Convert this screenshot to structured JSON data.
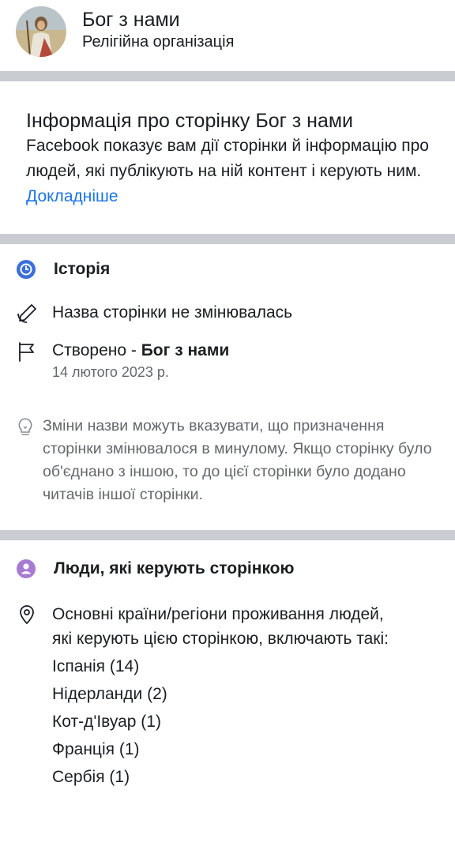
{
  "header": {
    "page_name": "Бог з нами",
    "category": "Релігійна організація"
  },
  "about": {
    "title": "Інформація про сторінку Бог з нами",
    "text": "Facebook показує вам дії сторінки й інформацію про людей, які публікують на ній контент і керують ним. ",
    "link": "Докладніше"
  },
  "history": {
    "title": "Історія",
    "name_unchanged": "Назва сторінки не змінювалась",
    "created_prefix": "Створено - ",
    "created_name": "Бог з нами",
    "created_date": "14 лютого 2023 р.",
    "tip": "Зміни назви можуть вказувати, що призначення сторінки змінювалося в минулому. Якщо сторінку було об'єднано з іншою, то до цієї сторінки було додано читачів іншої сторінки."
  },
  "people": {
    "title": "Люди, які керують сторінкою",
    "countries_intro": "Основні країни/регіони проживання людей, які керують цією сторінкою, включають такі:",
    "countries": [
      "Іспанія (14)",
      "Нідерланди (2)",
      "Кот-д'Івуар (1)",
      "Франція (1)",
      "Сербія (1)"
    ]
  },
  "icons": {
    "history": "clock-icon",
    "rename": "pencil-icon",
    "created": "flag-icon",
    "tip": "lightbulb-icon",
    "people": "person-icon",
    "location": "location-pin-icon"
  },
  "colors": {
    "history_icon": "#3b6fd9",
    "people_icon": "#a77bd1",
    "link": "#1b74e4",
    "divider": "#c9ccd1",
    "secondary_text": "#65676b"
  }
}
